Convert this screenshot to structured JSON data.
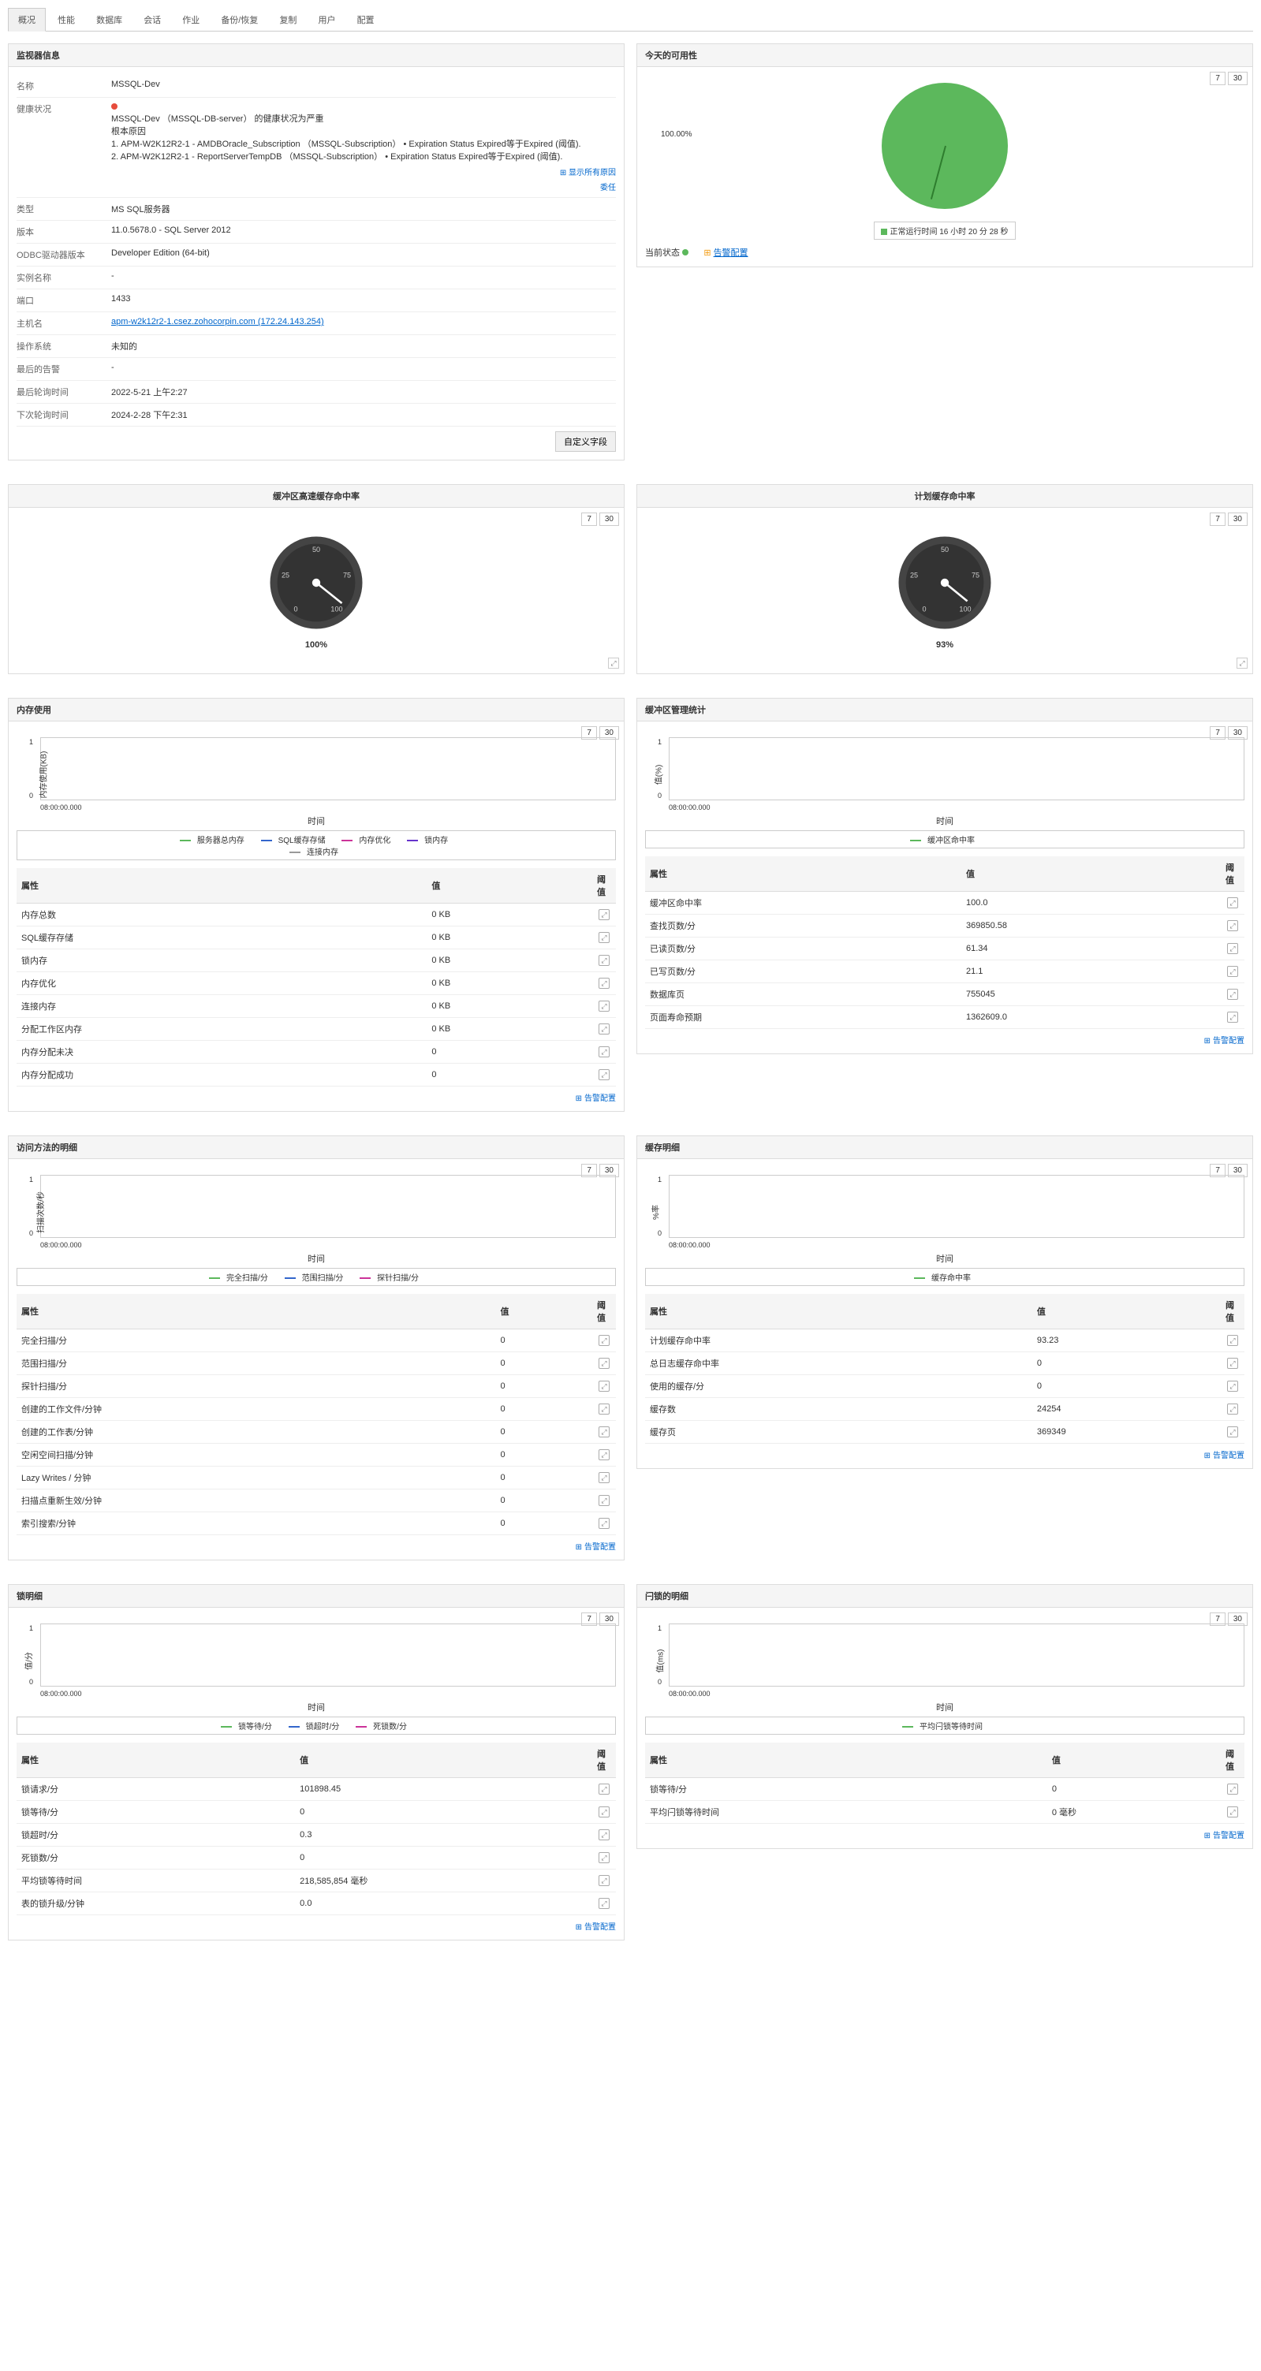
{
  "tabs": [
    "概况",
    "性能",
    "数据库",
    "会话",
    "作业",
    "备份/恢复",
    "复制",
    "用户",
    "配置"
  ],
  "monitor_info": {
    "title": "监视器信息",
    "rows": {
      "name_k": "名称",
      "name_v": "MSSQL-Dev",
      "health_k": "健康状况",
      "health_line1": "MSSQL-Dev （MSSQL-DB-server） 的健康状况为严重",
      "health_root": "根本原因",
      "health_l2": "1. APM-W2K12R2-1 - AMDBOracle_Subscription （MSSQL-Subscription） • Expiration Status Expired等于Expired (阈值).",
      "health_l3": "2. APM-W2K12R2-1 - ReportServerTempDB （MSSQL-Subscription） • Expiration Status Expired等于Expired (阈值).",
      "show_all": "显示所有原因",
      "delegate": "委任",
      "type_k": "类型",
      "type_v": "MS SQL服务器",
      "ver_k": "版本",
      "ver_v": "11.0.5678.0 - SQL Server 2012",
      "odbc_k": "ODBC驱动器版本",
      "odbc_v": "Developer Edition (64-bit)",
      "inst_k": "实例名称",
      "inst_v": "-",
      "port_k": "端口",
      "port_v": "1433",
      "host_k": "主机名",
      "host_v": "apm-w2k12r2-1.csez.zohocorpin.com (172.24.143.254)",
      "os_k": "操作系统",
      "os_v": "未知的",
      "last_alarm_k": "最后的告警",
      "last_alarm_v": "-",
      "last_poll_k": "最后轮询时间",
      "last_poll_v": "2022-5-21 上午2:27",
      "next_poll_k": "下次轮询时间",
      "next_poll_v": "2024-2-28 下午2:31"
    },
    "custom_btn": "自定义字段"
  },
  "avail": {
    "title": "今天的可用性",
    "pct": "100.00%",
    "legend": "正常运行时间 16 小时 20 分 28 秒",
    "cur_status": "当前状态",
    "alarm_cfg": "告警配置"
  },
  "btn7": "7",
  "btn30": "30",
  "gauge1": {
    "title": "缓冲区高速缓存命中率",
    "val": "100%"
  },
  "gauge2": {
    "title": "计划缓存命中率",
    "val": "93%"
  },
  "mem": {
    "title": "内存使用",
    "ylabel": "内存使用(KB)",
    "xlabel": "时间",
    "xtick": "08:00:00.000",
    "legend": [
      "服务器总内存",
      "SQL缓存存储",
      "内存优化",
      "锁内存",
      "连接内存"
    ],
    "th_attr": "属性",
    "th_val": "值",
    "th_thresh": "阈值",
    "rows": [
      {
        "a": "内存总数",
        "v": "0 KB"
      },
      {
        "a": "SQL缓存存储",
        "v": "0 KB"
      },
      {
        "a": "锁内存",
        "v": "0 KB"
      },
      {
        "a": "内存优化",
        "v": "0 KB"
      },
      {
        "a": "连接内存",
        "v": "0 KB"
      },
      {
        "a": "分配工作区内存",
        "v": "0 KB"
      },
      {
        "a": "内存分配未决",
        "v": "0"
      },
      {
        "a": "内存分配成功",
        "v": "0"
      }
    ]
  },
  "buf": {
    "title": "缓冲区管理统计",
    "ylabel": "值(%)",
    "xlabel": "时间",
    "xtick": "08:00:00.000",
    "legend": [
      "缓冲区命中率"
    ],
    "th_attr": "属性",
    "th_val": "值",
    "th_thresh": "阈值",
    "rows": [
      {
        "a": "缓冲区命中率",
        "v": "100.0"
      },
      {
        "a": "查找页数/分",
        "v": "369850.58"
      },
      {
        "a": "已读页数/分",
        "v": "61.34"
      },
      {
        "a": "已写页数/分",
        "v": "21.1"
      },
      {
        "a": "数据库页",
        "v": "755045"
      },
      {
        "a": "页面寿命预期",
        "v": "1362609.0"
      }
    ]
  },
  "access": {
    "title": "访问方法的明细",
    "ylabel": "扫描次数/秒",
    "xlabel": "时间",
    "xtick": "08:00:00.000",
    "legend": [
      "完全扫描/分",
      "范围扫描/分",
      "探针扫描/分"
    ],
    "th_attr": "属性",
    "th_val": "值",
    "th_thresh": "阈值",
    "rows": [
      {
        "a": "完全扫描/分",
        "v": "0"
      },
      {
        "a": "范围扫描/分",
        "v": "0"
      },
      {
        "a": "探针扫描/分",
        "v": "0"
      },
      {
        "a": "创建的工作文件/分钟",
        "v": "0"
      },
      {
        "a": "创建的工作表/分钟",
        "v": "0"
      },
      {
        "a": "空闲空间扫描/分钟",
        "v": "0"
      },
      {
        "a": "Lazy Writes / 分钟",
        "v": "0"
      },
      {
        "a": "扫描点重新生效/分钟",
        "v": "0"
      },
      {
        "a": "索引搜索/分钟",
        "v": "0"
      }
    ]
  },
  "cache": {
    "title": "缓存明细",
    "ylabel": "%率",
    "xlabel": "时间",
    "xtick": "08:00:00.000",
    "legend": [
      "缓存命中率"
    ],
    "th_attr": "属性",
    "th_val": "值",
    "th_thresh": "阈值",
    "rows": [
      {
        "a": "计划缓存命中率",
        "v": "93.23"
      },
      {
        "a": "总日志缓存命中率",
        "v": "0"
      },
      {
        "a": "使用的缓存/分",
        "v": "0"
      },
      {
        "a": "缓存数",
        "v": "24254"
      },
      {
        "a": "缓存页",
        "v": "369349"
      }
    ]
  },
  "lock": {
    "title": "锁明细",
    "ylabel": "值/分",
    "xlabel": "时间",
    "xtick": "08:00:00.000",
    "legend": [
      "锁等待/分",
      "锁超时/分",
      "死锁数/分"
    ],
    "th_attr": "属性",
    "th_val": "值",
    "th_thresh": "阈值",
    "rows": [
      {
        "a": "锁请求/分",
        "v": "101898.45"
      },
      {
        "a": "锁等待/分",
        "v": "0"
      },
      {
        "a": "锁超时/分",
        "v": "0.3"
      },
      {
        "a": "死锁数/分",
        "v": "0"
      },
      {
        "a": "平均锁等待时间",
        "v": "218,585,854 毫秒"
      },
      {
        "a": "表的锁升级/分钟",
        "v": "0.0"
      }
    ]
  },
  "latch": {
    "title": "闩锁的明细",
    "ylabel": "值(ms)",
    "xlabel": "时间",
    "xtick": "08:00:00.000",
    "legend": [
      "平均闩锁等待时间"
    ],
    "th_attr": "属性",
    "th_val": "值",
    "th_thresh": "阈值",
    "rows": [
      {
        "a": "锁等待/分",
        "v": "0"
      },
      {
        "a": "平均闩锁等待时间",
        "v": "0 毫秒"
      }
    ]
  },
  "alarm_cfg": "告警配置",
  "chart_data": [
    {
      "type": "pie",
      "title": "今天的可用性",
      "series": [
        {
          "name": "正常运行时间",
          "value": 100.0
        }
      ]
    },
    {
      "type": "gauge",
      "title": "缓冲区高速缓存命中率",
      "value": 100,
      "range": [
        0,
        100
      ]
    },
    {
      "type": "gauge",
      "title": "计划缓存命中率",
      "value": 93,
      "range": [
        0,
        100
      ]
    },
    {
      "type": "line",
      "title": "内存使用",
      "xlabel": "时间",
      "ylabel": "内存使用(KB)",
      "x": [
        "08:00:00.000"
      ],
      "series": [
        {
          "name": "服务器总内存",
          "values": [
            0
          ]
        },
        {
          "name": "SQL缓存存储",
          "values": [
            0
          ]
        },
        {
          "name": "内存优化",
          "values": [
            0
          ]
        },
        {
          "name": "锁内存",
          "values": [
            0
          ]
        },
        {
          "name": "连接内存",
          "values": [
            0
          ]
        }
      ],
      "ylim": [
        0,
        1
      ]
    },
    {
      "type": "line",
      "title": "缓冲区管理统计",
      "xlabel": "时间",
      "ylabel": "值(%)",
      "x": [
        "08:00:00.000"
      ],
      "series": [
        {
          "name": "缓冲区命中率",
          "values": [
            0
          ]
        }
      ],
      "ylim": [
        0,
        1
      ]
    },
    {
      "type": "line",
      "title": "访问方法的明细",
      "xlabel": "时间",
      "ylabel": "扫描次数/秒",
      "x": [
        "08:00:00.000"
      ],
      "series": [
        {
          "name": "完全扫描/分",
          "values": [
            0
          ]
        },
        {
          "name": "范围扫描/分",
          "values": [
            0
          ]
        },
        {
          "name": "探针扫描/分",
          "values": [
            0
          ]
        }
      ],
      "ylim": [
        0,
        1
      ]
    },
    {
      "type": "line",
      "title": "缓存明细",
      "xlabel": "时间",
      "ylabel": "%率",
      "x": [
        "08:00:00.000"
      ],
      "series": [
        {
          "name": "缓存命中率",
          "values": [
            0
          ]
        }
      ],
      "ylim": [
        0,
        1
      ]
    },
    {
      "type": "line",
      "title": "锁明细",
      "xlabel": "时间",
      "ylabel": "值/分",
      "x": [
        "08:00:00.000"
      ],
      "series": [
        {
          "name": "锁等待/分",
          "values": [
            0
          ]
        },
        {
          "name": "锁超时/分",
          "values": [
            0
          ]
        },
        {
          "name": "死锁数/分",
          "values": [
            0
          ]
        }
      ],
      "ylim": [
        0,
        1
      ]
    },
    {
      "type": "line",
      "title": "闩锁的明细",
      "xlabel": "时间",
      "ylabel": "值(ms)",
      "x": [
        "08:00:00.000"
      ],
      "series": [
        {
          "name": "平均闩锁等待时间",
          "values": [
            0
          ]
        }
      ],
      "ylim": [
        0,
        1
      ]
    }
  ]
}
